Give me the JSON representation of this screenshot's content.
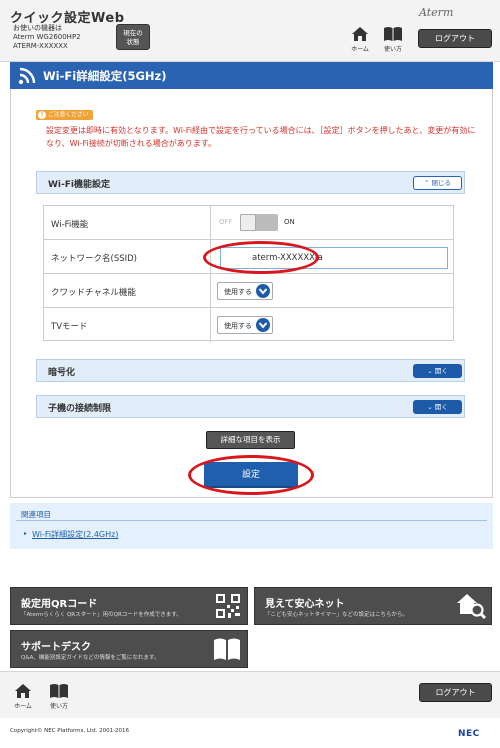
{
  "header": {
    "app_title": "クイック設定Web",
    "device_label": "お使いの機器は",
    "device_model": "Aterm WG2600HP2",
    "device_name": "ATERM-XXXXXX",
    "status_button_line1": "現在の",
    "status_button_line2": "状態",
    "brand_logo": "Aterm",
    "home_label": "ホーム",
    "help_label": "使い方",
    "logout_label": "ログアウト"
  },
  "page": {
    "title": "Wi-Fi詳細設定(5GHz)"
  },
  "caution": {
    "badge": "ご注意ください",
    "text": "設定変更は即時に有効となります。Wi-Fi経由で設定を行っている場合には、［設定］ボタンを押したあと、変更が有効になり、Wi-Fi接続が切断される場合があります。"
  },
  "wifi_section": {
    "title": "Wi-Fi機能設定",
    "toggle_label": "閉じる",
    "rows": {
      "wifi": {
        "label": "Wi-Fi機能",
        "off_label": "OFF",
        "on_label": "ON",
        "state": "ON"
      },
      "ssid": {
        "label": "ネットワーク名(SSID)",
        "value": "aterm-XXXXXX-a"
      },
      "cloud": {
        "label": "クワッドチャネル機能",
        "value": "使用する"
      },
      "tv": {
        "label": "TVモード",
        "value": "使用する"
      }
    }
  },
  "encryption_section": {
    "title": "暗号化",
    "toggle_label": "開く"
  },
  "restriction_section": {
    "title": "子機の接続制限",
    "toggle_label": "開く"
  },
  "buttons": {
    "show_detail": "詳細な項目を表示",
    "submit": "設定"
  },
  "related": {
    "title": "関連項目",
    "link": "Wi-Fi詳細設定(2.4GHz)"
  },
  "tiles": {
    "qr": {
      "title": "設定用QRコード",
      "sub": "「Atermらくらく QRスタート」用のQRコードを作成できます。"
    },
    "safety": {
      "title": "見えて安心ネット",
      "sub": "「こども安心ネットタイマー」などの設定はこちらから。"
    },
    "support": {
      "title": "サポートデスク",
      "sub": "Q&A、機能別設定ガイドなどの情報をご覧になれます。"
    }
  },
  "footer": {
    "home_label": "ホーム",
    "help_label": "使い方",
    "logout_label": "ログアウト",
    "copyright": "Copyright© NEC Platforms, Ltd. 2001-2016",
    "nec_logo": "NEC"
  },
  "colors": {
    "accent_blue": "#2a63b2",
    "highlight_red": "#d8161c",
    "caution_orange": "#f1a338",
    "caution_text": "#d5322a"
  }
}
